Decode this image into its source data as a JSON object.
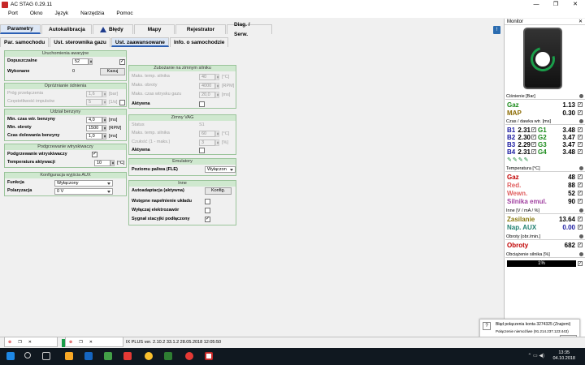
{
  "window": {
    "title": "AC STAG 0.29.11",
    "controls": [
      "—",
      "❐",
      "✕"
    ]
  },
  "menu": [
    "Port",
    "Okno",
    "Język",
    "Narzędzia",
    "Pomoc"
  ],
  "tabs_main": [
    "Parametry",
    "Autokalibracja",
    "Błędy",
    "Mapy",
    "Rejestrator",
    "Diag. / Serw."
  ],
  "tabs_sub": [
    "Par. samochodu",
    "Ust. sterownika gazu",
    "Ust. zaawansowane",
    "Info. o samochodzie"
  ],
  "panel_uruchomienie": {
    "title": "Uruchomienia awaryjne",
    "dopuszczalne_label": "Dopuszczalne",
    "dopuszczalne_value": "52",
    "wykonane_label": "Wykonane",
    "wykonane_value": "0",
    "kasuj": "Kasuj"
  },
  "panel_oproznianie": {
    "title": "Opróżnianie śdnienia",
    "prog_label": "Próg przełączenia",
    "prog_value": "1,6",
    "prog_unit": "[bar]",
    "czest_label": "Częstotliwość impulsów",
    "czest_value": "5",
    "czest_unit": "[1/s]"
  },
  "panel_udzial": {
    "title": "Udział benzyny",
    "min_czas_label": "Min. czas wtr. benzyny",
    "min_czas_value": "4,0",
    "min_czas_unit": "[ms]",
    "min_obroty_label": "Min. obroty",
    "min_obroty_value": "1500",
    "min_obroty_unit": "[RPM]",
    "czas_dol_label": "Czas dolewania benzyny",
    "czas_dol_value": "1,0",
    "czas_dol_unit": "[ms]"
  },
  "panel_podgrzewanie": {
    "title": "Podgrzewanie wtryskiwaczy",
    "podgrz_label": "Podgrzewanie wtryskiwaczy",
    "temp_label": "Temperatura aktywacji",
    "temp_value": "10",
    "temp_unit": "[°C]"
  },
  "panel_aux": {
    "title": "Konfiguracja wyjścia AUX",
    "funkcja_label": "Funkcja",
    "funkcja_value": "Wyłączony",
    "polaryzacja_label": "Polaryzacja",
    "polaryzacja_value": "0 V"
  },
  "panel_zubozanie": {
    "title": "Zubożanie na zimnym silniku",
    "maks_temp_label": "Maks. temp. silnika",
    "maks_temp_value": "40",
    "maks_temp_unit": "[°C]",
    "maks_obroty_label": "Maks. obroty",
    "maks_obroty_value": "4000",
    "maks_obroty_unit": "[RPM]",
    "maks_czas_label": "Maks. czas wtrysku gazu",
    "maks_czas_value": "20,0",
    "maks_czas_unit": "[ms]",
    "aktywna_label": "Aktywna"
  },
  "panel_zimny_vag": {
    "title": "Zimny VAG",
    "status_label": "Status",
    "status_value": "S1",
    "maks_temp_label": "Maks. temp. silnika",
    "maks_temp_value": "60",
    "maks_temp_unit": "[°C]",
    "czulosc_label": "Czułość (1 - maks.)",
    "czulosc_value": "3",
    "czulosc_unit": "[%]",
    "aktywna_label": "Aktywna"
  },
  "panel_emulatory": {
    "title": "Emulatory",
    "poziom_label": "Poziomu paliwa (FLE)",
    "poziom_value": "Wyłączon"
  },
  "panel_inne": {
    "title": "Inne",
    "autoadapt_label": "Autoadaptacja (aktywna)",
    "konfig": "Konfig.",
    "wstepne_label": "Wstępne napełnienie układu",
    "wylaczaj_label": "Wyłączaj elektrozawór",
    "sygnal_label": "Sygnał stacyjki podłączony"
  },
  "monitor": {
    "title": "Monitor",
    "cisnienie_head": "Ciśnienie [Bar]",
    "gaz_label": "Gaz",
    "gaz_value": "1.13",
    "map_label": "MAP",
    "map_value": "0.30",
    "czas_head": "Czas / dawka wtr. [ms]",
    "b_labels": [
      "B1",
      "B2",
      "B3",
      "B4"
    ],
    "b_values": [
      "2.31",
      "2.30",
      "2.29",
      "2.31"
    ],
    "g_labels": [
      "G1",
      "G2",
      "G3",
      "G4"
    ],
    "g_values": [
      "3.48",
      "3.47",
      "3.47",
      "3.48"
    ],
    "temp_head": "Temperatura [°C]",
    "t_gaz_label": "Gaz",
    "t_gaz_value": "48",
    "t_red_label": "Red.",
    "t_red_value": "88",
    "t_wewn_label": "Wewn.",
    "t_wewn_value": "52",
    "t_silnika_label": "Silnika emul.",
    "t_silnika_value": "90",
    "inne_head": "Inne [V / mA / %]",
    "zasilanie_label": "Zasilanie",
    "zasilanie_value": "13.64",
    "napaux_label": "Nap. AUX",
    "napaux_value": "0.00",
    "obroty_head": "Obroty [obr./min.]",
    "obroty_label": "Obroty",
    "obroty_value": "682",
    "obciazenie_head": "Obciążenie silnika [%]",
    "obciazenie_value": "1%"
  },
  "notification": {
    "title": "Błąd połączenia konta 3274325 (Znajomi)",
    "text": "Połączenie niemożliwe (91.214.237.123:443)",
    "button": "Ignore"
  },
  "statusbar": {
    "text": "IX PLUS   ver. 2.10.2   33.1.2    28.05.2018 12:05:50"
  },
  "taskbar": {
    "time": "13:35",
    "date": "04.10.2018"
  },
  "colors": {
    "gaz": "#1a8a1a",
    "map": "#8b6a00",
    "blue": "#1a1aa0",
    "red": "#c00000",
    "pink": "#e06060",
    "magenta": "#a040a0",
    "olive": "#8a7a10",
    "teal": "#208070"
  }
}
